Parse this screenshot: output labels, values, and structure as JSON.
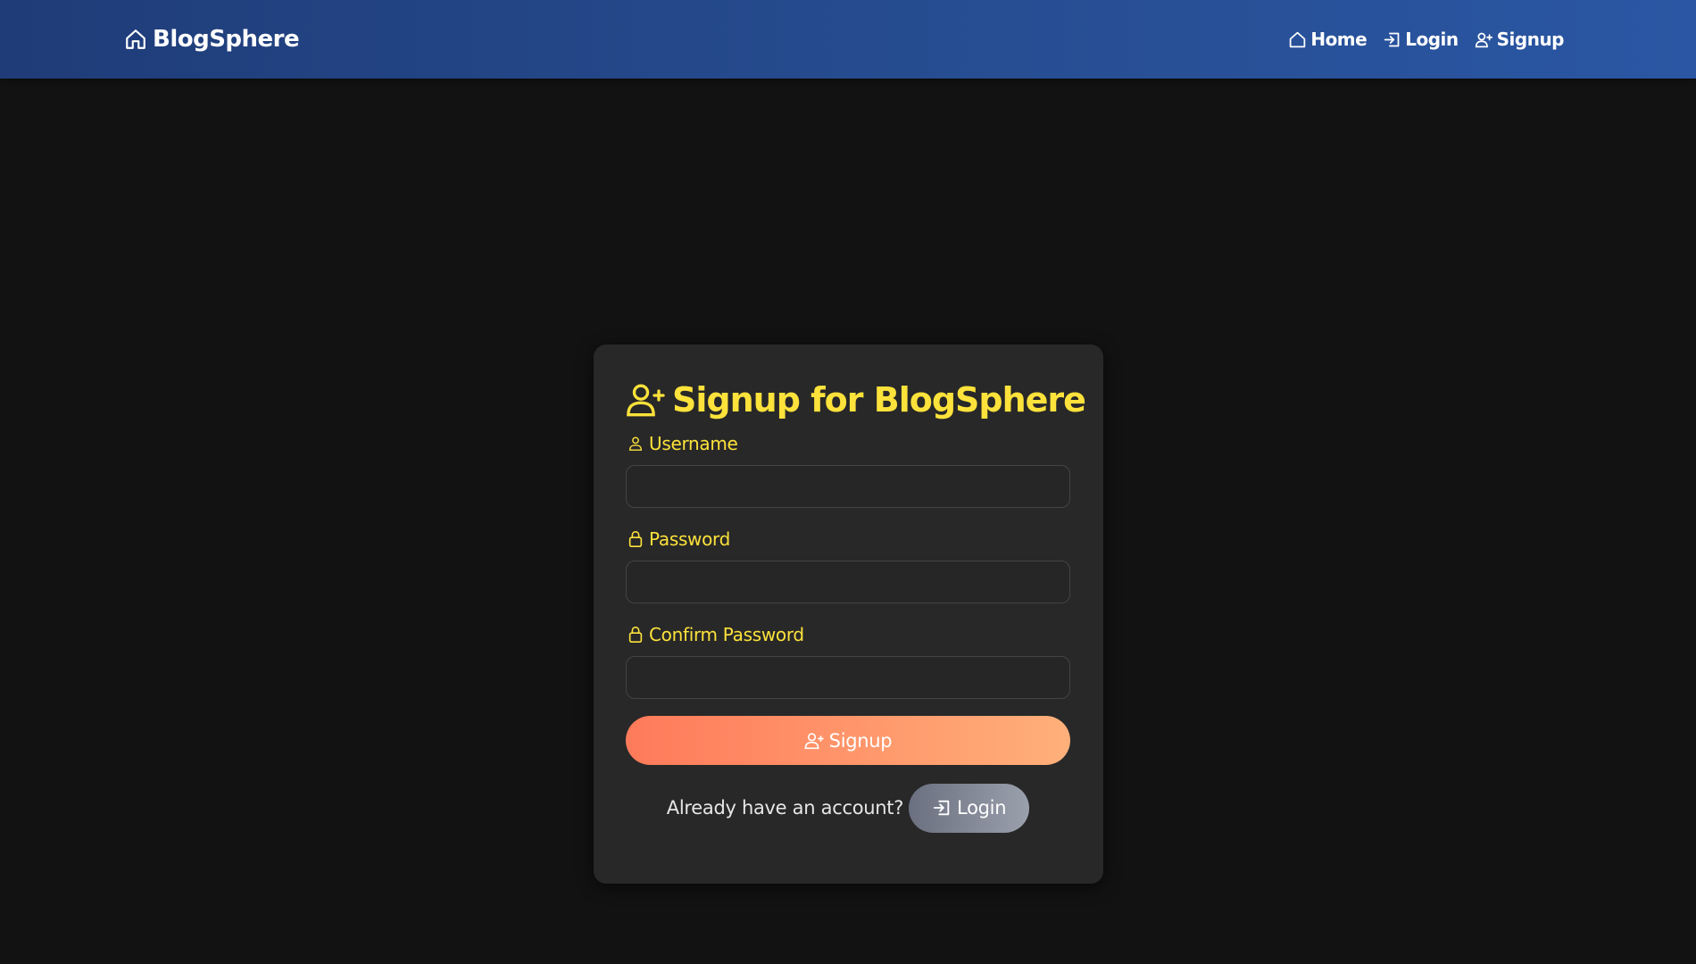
{
  "navbar": {
    "brand": {
      "icon": "home-icon",
      "label": "BlogSphere"
    },
    "links": [
      {
        "icon": "home-icon",
        "label": "Home"
      },
      {
        "icon": "login-icon",
        "label": "Login"
      },
      {
        "icon": "person-add-icon",
        "label": "Signup"
      }
    ]
  },
  "form": {
    "title": "Signup for BlogSphere",
    "title_icon": "person-add-icon",
    "fields": [
      {
        "icon": "person-icon",
        "label": "Username",
        "value": ""
      },
      {
        "icon": "lock-icon",
        "label": "Password",
        "value": ""
      },
      {
        "icon": "lock-icon",
        "label": "Confirm Password",
        "value": ""
      }
    ],
    "submit_label": "Signup",
    "footer_text": "Already have an account?",
    "login_label": "Login"
  },
  "colors": {
    "navbar": "#274e93",
    "background": "#121212",
    "card": "#282828",
    "accent_yellow": "#fde23b",
    "signup_gradient_start": "#ff7a5a",
    "signup_gradient_end": "#ffb07a",
    "login_gradient_start": "#6b7080",
    "login_gradient_end": "#9aa0ac"
  }
}
